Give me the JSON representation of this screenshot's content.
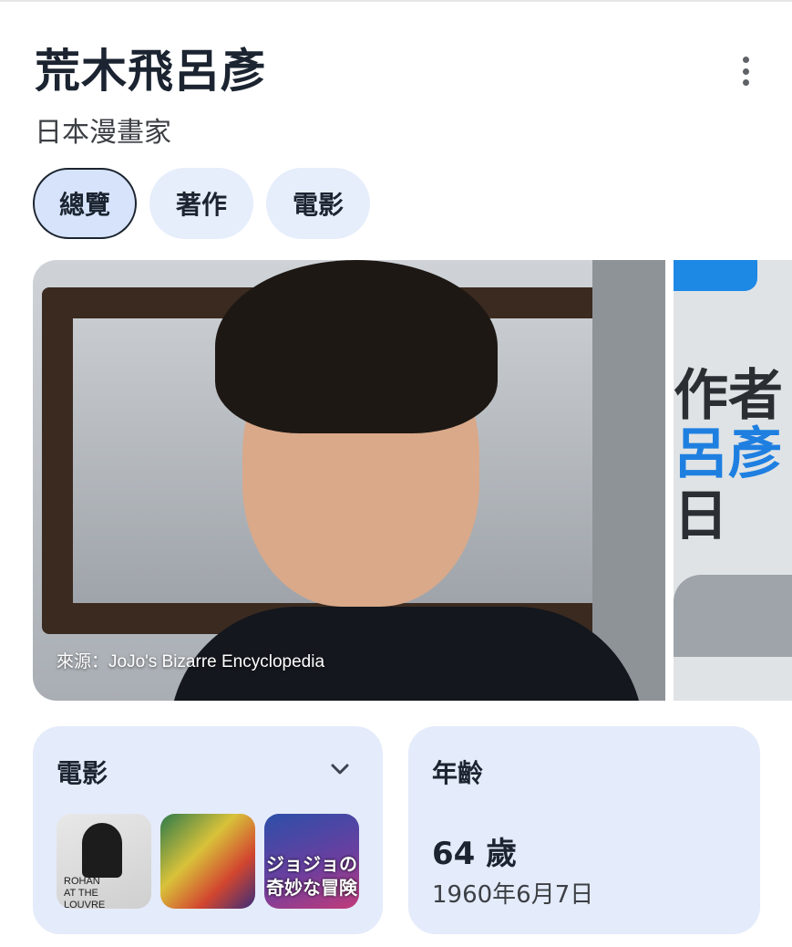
{
  "header": {
    "title": "荒木飛呂彥",
    "subtitle": "日本漫畫家"
  },
  "tabs": [
    {
      "label": "總覽",
      "active": true
    },
    {
      "label": "著作",
      "active": false
    },
    {
      "label": "電影",
      "active": false
    }
  ],
  "gallery": {
    "main_caption": "來源：JoJo's Bizarre Encyclopedia",
    "peek_text": [
      "作者",
      "呂彥",
      "日"
    ]
  },
  "movies_card": {
    "title": "電影",
    "thumbnails": [
      {
        "text": "ROHAN\nAT THE\nLOUVRE"
      },
      {
        "text": ""
      },
      {
        "text": "ジョジョの\n奇妙な冒険"
      }
    ]
  },
  "age_card": {
    "title": "年齡",
    "value": "64 歲",
    "birth_date": "1960年6月7日"
  },
  "colors": {
    "chip_bg": "#e6edfb",
    "card_bg": "#e4ebfa",
    "title_text": "#1b2430"
  }
}
